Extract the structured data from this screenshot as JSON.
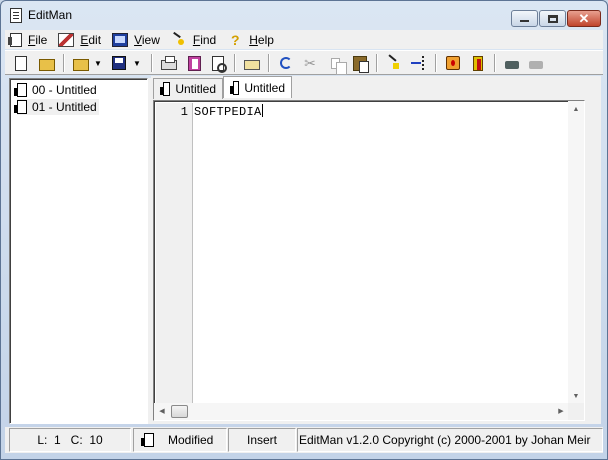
{
  "window": {
    "title": "EditMan"
  },
  "menu": {
    "items": [
      {
        "label": "File",
        "icon": "file-icon"
      },
      {
        "label": "Edit",
        "icon": "edit-icon"
      },
      {
        "label": "View",
        "icon": "view-icon"
      },
      {
        "label": "Find",
        "icon": "find-icon"
      },
      {
        "label": "Help",
        "icon": "help-icon"
      }
    ]
  },
  "toolbar": {
    "buttons": [
      "new",
      "open",
      "open-dropdown",
      "save",
      "save-dropdown",
      "print",
      "book",
      "print-preview",
      "mail",
      "undo",
      "cut",
      "copy",
      "paste",
      "mark",
      "goto-line",
      "favorites",
      "exit",
      "previous-document",
      "next-document"
    ]
  },
  "documents": {
    "items": [
      {
        "label": "00 - Untitled"
      },
      {
        "label": "01 - Untitled"
      }
    ]
  },
  "tabs": {
    "items": [
      {
        "label": "Untitled"
      },
      {
        "label": "Untitled"
      }
    ]
  },
  "editor": {
    "lines": [
      {
        "number": "1",
        "text": "SOFTPEDIA"
      }
    ]
  },
  "status": {
    "line": "L:  1",
    "column": "C:  10",
    "modified": "Modified",
    "mode": "Insert",
    "copyright": "EditMan v1.2.0 Copyright (c) 2000-2001 by Johan Meir"
  },
  "colors": {
    "chrome": "#f0f0f0",
    "title_gradient_top": "#dbe6f3",
    "close_button": "#c0452c"
  }
}
